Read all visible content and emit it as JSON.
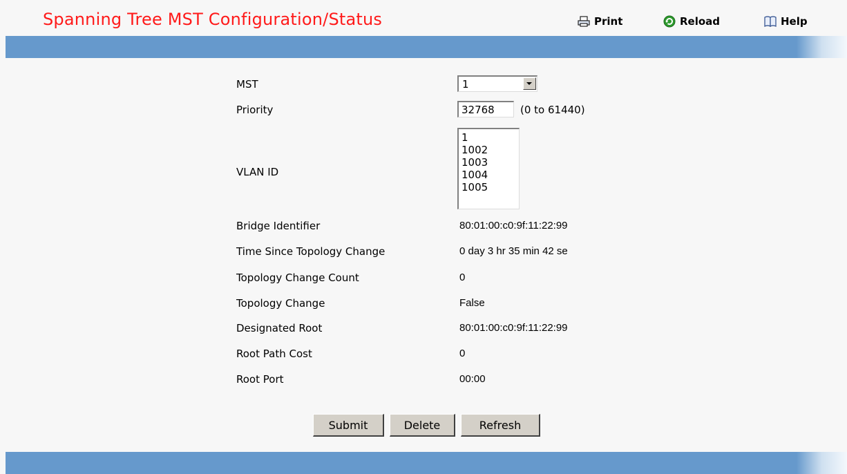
{
  "header": {
    "title": "Spanning Tree MST Configuration/Status",
    "print_label": "Print",
    "reload_label": "Reload",
    "help_label": "Help",
    "bar_color": "#6699cc",
    "title_color": "#ff1a1a"
  },
  "icons": {
    "print": "printer-icon",
    "reload": "reload-icon",
    "help": "help-book-icon",
    "dropdown": "chevron-down-icon"
  },
  "form": {
    "mst": {
      "label": "MST",
      "selected": "1"
    },
    "priority": {
      "label": "Priority",
      "value": "32768",
      "range": "(0 to 61440)"
    },
    "vlan": {
      "label": "VLAN ID",
      "options": [
        "1",
        "1002",
        "1003",
        "1004",
        "1005"
      ]
    },
    "status": [
      {
        "label": "Bridge Identifier",
        "value": "80:01:00:c0:9f:11:22:99"
      },
      {
        "label": "Time Since Topology Change",
        "value": "0 day 3 hr 35 min 42 se"
      },
      {
        "label": "Topology Change Count",
        "value": "0"
      },
      {
        "label": "Topology Change",
        "value": "False"
      },
      {
        "label": "Designated Root",
        "value": "80:01:00:c0:9f:11:22:99"
      },
      {
        "label": "Root Path Cost",
        "value": "0"
      },
      {
        "label": "Root Port",
        "value": "00:00"
      }
    ]
  },
  "buttons": {
    "submit": "Submit",
    "delete": "Delete",
    "refresh": "Refresh"
  }
}
